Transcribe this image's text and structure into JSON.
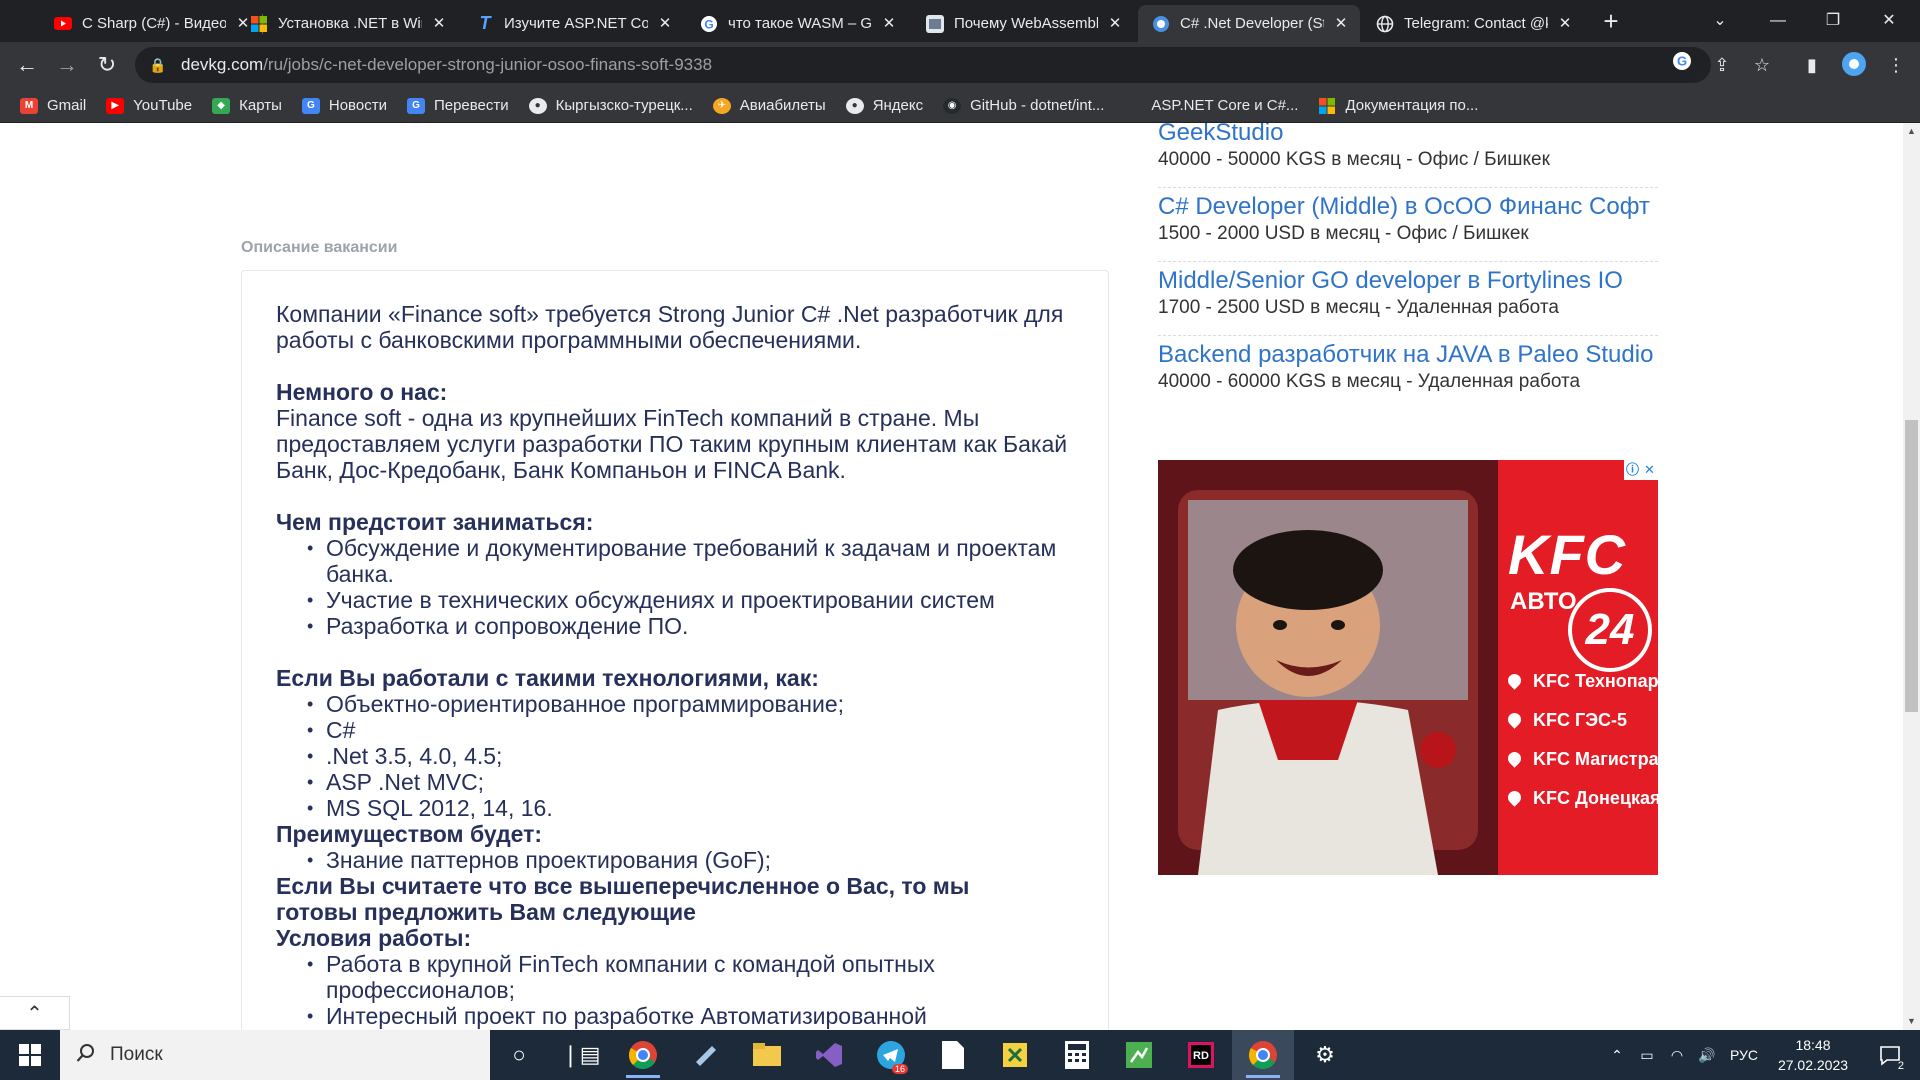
{
  "browser": {
    "tabs": [
      {
        "title": "C Sharp (C#) - Видеоуроки",
        "icon": "youtube-icon",
        "active": false
      },
      {
        "title": "Установка .NET в Windows",
        "icon": "windows-icon",
        "active": false
      },
      {
        "title": "Изучите ASP.NET Core",
        "icon": "typora-icon",
        "active": false
      },
      {
        "title": "что такое WASM – Google",
        "icon": "google-icon",
        "active": false
      },
      {
        "title": "Почему WebAssembly",
        "icon": "habr-icon",
        "active": false
      },
      {
        "title": "C# .Net Developer (Strong",
        "icon": "devkg-icon",
        "active": true
      },
      {
        "title": "Telegram: Contact @k",
        "icon": "globe-icon",
        "active": false
      }
    ],
    "url_host": "devkg.com",
    "url_path": "/ru/jobs/c-net-developer-strong-junior-osoo-finans-soft-9338",
    "bookmarks": [
      {
        "label": "Gmail",
        "icon": "gmail-icon",
        "color": "#ea4335"
      },
      {
        "label": "YouTube",
        "icon": "youtube-icon",
        "color": "#ff0000"
      },
      {
        "label": "Карты",
        "icon": "maps-icon",
        "color": "#34a853"
      },
      {
        "label": "Новости",
        "icon": "news-icon",
        "color": "#4285f4"
      },
      {
        "label": "Перевести",
        "icon": "translate-icon",
        "color": "#4285f4"
      },
      {
        "label": "Кыргызско-турецк...",
        "icon": "globe-icon",
        "color": "#5f6368"
      },
      {
        "label": "Авиабилеты",
        "icon": "aviasales-icon",
        "color": "#f5a623"
      },
      {
        "label": "Яндекс",
        "icon": "globe-icon",
        "color": "#5f6368"
      },
      {
        "label": "GitHub - dotnet/int...",
        "icon": "github-icon",
        "color": "#24292e"
      },
      {
        "label": "ASP.NET Core и C#...",
        "icon": "blank-icon",
        "color": "#35363a"
      },
      {
        "label": "Документация по...",
        "icon": "microsoft-icon",
        "color": "#00a4ef"
      }
    ]
  },
  "page": {
    "section_label": "Описание вакансии",
    "intro": "Компании «Finance soft» требуется Strong Junior C# .Net разработчик для работы с банковскими программными обеспечениями.",
    "about_heading": "Немного о нас:",
    "about_text": "Finance soft - одна из крупнейших FinTech компаний в стране. Мы предоставляем услуги разработки ПО таким крупным клиентам как Бакай Банк, Дос-Кредобанк, Банк Компаньон и FINCA Bank.",
    "tasks_heading": "Чем предстоит заниматься:",
    "tasks": [
      "Обсуждение и документирование требований к задачам и проектам банка.",
      "Участие в технических обсуждениях и проектировании систем",
      "Разработка и сопровождение ПО."
    ],
    "tech_heading": "Если Вы работали с такими технологиями, как:",
    "tech": [
      "Объектно-ориентированное программирование;",
      "C#",
      ".Net 3.5, 4.0, 4.5;",
      "ASP .Net MVC;",
      "MS SQL 2012, 14, 16."
    ],
    "plus_heading": "Преимуществом будет:",
    "plus": [
      "Знание паттернов проектирования (GoF);"
    ],
    "offer_heading": "Если Вы считаете что все вышеперечисленное о Вас, то мы готовы предложить Вам следующие",
    "conditions_heading": "Условия работы:",
    "conditions": [
      "Работа в крупной FinTech компании с командой опытных профессионалов;",
      "Интересный проект по разработке Автоматизированной"
    ]
  },
  "sidebar": {
    "jobs": [
      {
        "title": "GeekStudio",
        "meta": "40000 - 50000 KGS в месяц - Офис / Бишкек"
      },
      {
        "title": "C# Developer (Middle) в ОсОО Финанс Софт",
        "meta": "1500 - 2000 USD в месяц - Офис / Бишкек"
      },
      {
        "title": "Middle/Senior GO developer в Fortylines IO",
        "meta": "1700 - 2500 USD в месяц - Удаленная работа"
      },
      {
        "title": "Backend разработчик на JAVA в Paleo Studio",
        "meta": "40000 - 60000 KGS в месяц - Удаленная работа"
      }
    ]
  },
  "ad": {
    "brand": "KFC",
    "sub": "АВТО",
    "number": "24",
    "locations": [
      "KFC Технопарк",
      "KFC ГЭС-5",
      "KFC Магистраль",
      "KFC Донецкая"
    ],
    "brand_color": "#e31c25"
  },
  "taskbar": {
    "search_label": "Поиск",
    "lang": "РУС",
    "time": "18:48",
    "date": "27.02.2023",
    "notif_count": "2",
    "telegram_badge": "16"
  }
}
